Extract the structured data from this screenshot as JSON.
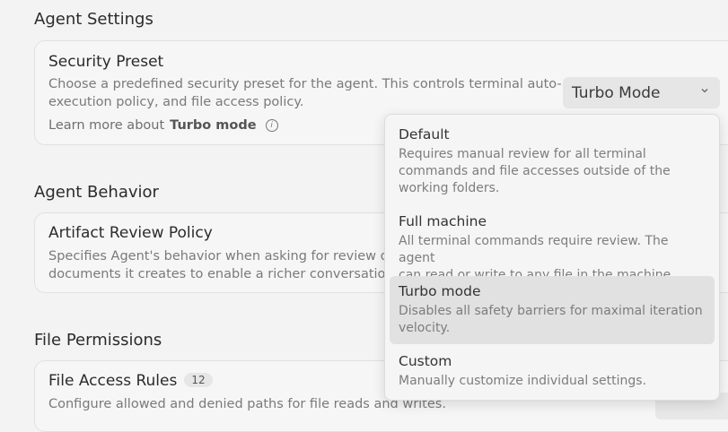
{
  "sections": {
    "agent_settings": "Agent Settings",
    "agent_behavior": "Agent Behavior",
    "file_permissions": "File Permissions"
  },
  "security_preset": {
    "title": "Security Preset",
    "description_line1": "Choose a predefined security preset for the agent. This controls terminal auto-",
    "description_line2": "execution policy, and file access policy.",
    "learn_more_prefix": "Learn more about",
    "learn_more_link": "Turbo mode",
    "selected_value": "Turbo Mode"
  },
  "artifact_review": {
    "title": "Artifact Review Policy",
    "description_line1": "Specifies Agent's behavior when asking for review on",
    "description_line2": "documents it creates to enable a richer conversation e"
  },
  "file_access": {
    "title": "File Access Rules",
    "count": "12",
    "description": "Configure allowed and denied paths for file reads and writes."
  },
  "dropdown": {
    "options": [
      {
        "title": "Default",
        "desc_line1": "Requires manual review for all terminal",
        "desc_line2": "commands and file accesses outside of the",
        "desc_line3": "working folders."
      },
      {
        "title": "Full machine",
        "desc_line1": "All terminal commands require review. The agent",
        "desc_line2": "can read or write to any file in the machine."
      },
      {
        "title": "Turbo mode",
        "desc_line1": "Disables all safety barriers for maximal iteration",
        "desc_line2": "velocity."
      },
      {
        "title": "Custom",
        "desc_line1": "Manually customize individual settings."
      }
    ]
  }
}
